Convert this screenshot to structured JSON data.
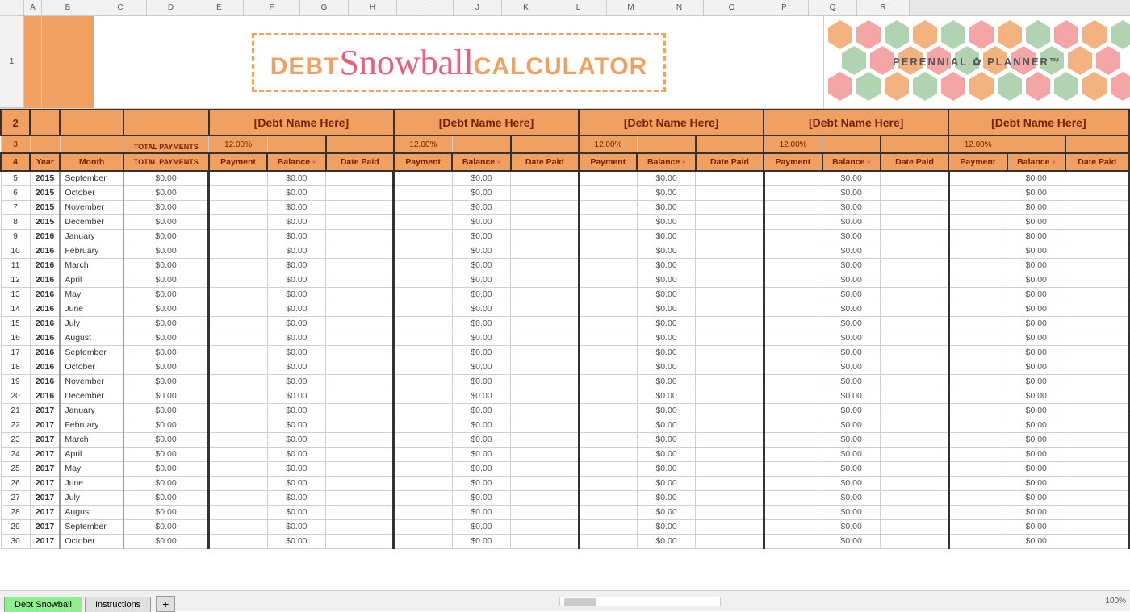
{
  "banner": {
    "title_prefix": "DEBT",
    "title_cursive": "Snowball",
    "title_suffix": "CALCULATOR",
    "logo": "PERENNIAL ✿ PLANNER™"
  },
  "col_headers": [
    "",
    "A",
    "B",
    "C",
    "D",
    "E",
    "F",
    "G",
    "H",
    "I",
    "J",
    "K",
    "L",
    "M",
    "N",
    "O",
    "P",
    "Q",
    "R"
  ],
  "header": {
    "debt_name": "[Debt Name Here]",
    "rate": "12.00%",
    "total_payments": "TOTAL PAYMENTS",
    "year_label": "Year",
    "month_label": "Month",
    "payment_label": "Payment",
    "balance_label": "Balance",
    "date_paid_label": "Date Paid"
  },
  "rows": [
    {
      "row": 5,
      "year": "2015",
      "month": "September"
    },
    {
      "row": 6,
      "year": "2015",
      "month": "October"
    },
    {
      "row": 7,
      "year": "2015",
      "month": "November"
    },
    {
      "row": 8,
      "year": "2015",
      "month": "December"
    },
    {
      "row": 9,
      "year": "2016",
      "month": "January"
    },
    {
      "row": 10,
      "year": "2016",
      "month": "February"
    },
    {
      "row": 11,
      "year": "2016",
      "month": "March"
    },
    {
      "row": 12,
      "year": "2016",
      "month": "April"
    },
    {
      "row": 13,
      "year": "2016",
      "month": "May"
    },
    {
      "row": 14,
      "year": "2016",
      "month": "June"
    },
    {
      "row": 15,
      "year": "2016",
      "month": "July"
    },
    {
      "row": 16,
      "year": "2016",
      "month": "August"
    },
    {
      "row": 17,
      "year": "2016",
      "month": "September"
    },
    {
      "row": 18,
      "year": "2016",
      "month": "October"
    },
    {
      "row": 19,
      "year": "2016",
      "month": "November"
    },
    {
      "row": 20,
      "year": "2016",
      "month": "December"
    },
    {
      "row": 21,
      "year": "2017",
      "month": "January"
    },
    {
      "row": 22,
      "year": "2017",
      "month": "February"
    },
    {
      "row": 23,
      "year": "2017",
      "month": "March"
    },
    {
      "row": 24,
      "year": "2017",
      "month": "April"
    },
    {
      "row": 25,
      "year": "2017",
      "month": "May"
    },
    {
      "row": 26,
      "year": "2017",
      "month": "June"
    },
    {
      "row": 27,
      "year": "2017",
      "month": "July"
    },
    {
      "row": 28,
      "year": "2017",
      "month": "August"
    },
    {
      "row": 29,
      "year": "2017",
      "month": "September"
    },
    {
      "row": 30,
      "year": "2017",
      "month": "October"
    }
  ],
  "zero": "$0.00",
  "tabs": [
    {
      "label": "Debt Snowball",
      "active": true
    },
    {
      "label": "Instructions",
      "active": false
    }
  ]
}
